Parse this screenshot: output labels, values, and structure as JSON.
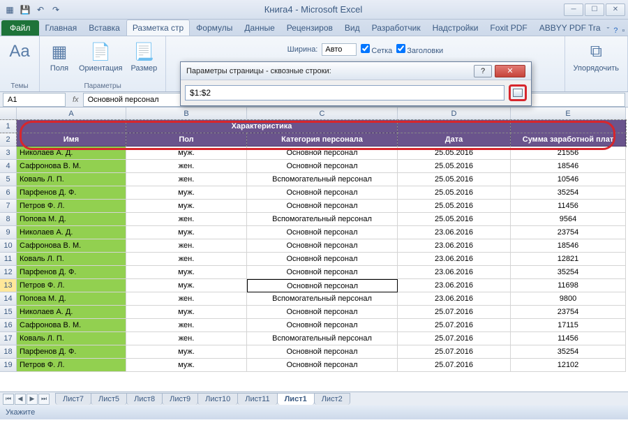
{
  "window": {
    "title": "Книга4 - Microsoft Excel"
  },
  "ribbon": {
    "file": "Файл",
    "tabs": [
      "Главная",
      "Вставка",
      "Разметка стр",
      "Формулы",
      "Данные",
      "Рецензиров",
      "Вид",
      "Разработчик",
      "Надстройки",
      "Foxit PDF",
      "ABBYY PDF Tra"
    ],
    "active_tab": "Разметка стр",
    "groups": {
      "themes": "Темы",
      "fields": "Поля",
      "orient": "Ориентация",
      "size": "Размер",
      "params": "Параметры",
      "arrange": "Упорядочить",
      "width": "Ширина:",
      "height_auto": "Авто",
      "grid": "Сетка",
      "headings": "Заголовки"
    }
  },
  "formula": {
    "namebox": "A1",
    "fx": "fx",
    "value": "Основной персонал"
  },
  "dialog": {
    "title": "Параметры страницы - сквозные строки:",
    "value": "$1:$2"
  },
  "columns": [
    "A",
    "B",
    "C",
    "D",
    "E"
  ],
  "header_row1": {
    "name": "Имя",
    "char": "Характеристика",
    "date": "Дата",
    "salary": "Сумма заработной плат"
  },
  "header_row2": {
    "gender": "Пол",
    "category": "Категория персонала"
  },
  "rows": [
    {
      "n": 3,
      "name": "Николаев А. Д.",
      "g": "муж.",
      "cat": "Основной персонал",
      "d": "25.05.2016",
      "s": "21556"
    },
    {
      "n": 4,
      "name": "Сафронова В. М.",
      "g": "жен.",
      "cat": "Основной персонал",
      "d": "25.05.2016",
      "s": "18546"
    },
    {
      "n": 5,
      "name": "Коваль Л. П.",
      "g": "жен.",
      "cat": "Вспомогательный персонал",
      "d": "25.05.2016",
      "s": "10546"
    },
    {
      "n": 6,
      "name": "Парфенов Д. Ф.",
      "g": "муж.",
      "cat": "Основной персонал",
      "d": "25.05.2016",
      "s": "35254"
    },
    {
      "n": 7,
      "name": "Петров Ф. Л.",
      "g": "муж.",
      "cat": "Основной персонал",
      "d": "25.05.2016",
      "s": "11456"
    },
    {
      "n": 8,
      "name": "Попова М. Д.",
      "g": "жен.",
      "cat": "Вспомогательный персонал",
      "d": "25.05.2016",
      "s": "9564"
    },
    {
      "n": 9,
      "name": "Николаев А. Д.",
      "g": "муж.",
      "cat": "Основной персонал",
      "d": "23.06.2016",
      "s": "23754"
    },
    {
      "n": 10,
      "name": "Сафронова В. М.",
      "g": "жен.",
      "cat": "Основной персонал",
      "d": "23.06.2016",
      "s": "18546"
    },
    {
      "n": 11,
      "name": "Коваль Л. П.",
      "g": "жен.",
      "cat": "Основной персонал",
      "d": "23.06.2016",
      "s": "12821"
    },
    {
      "n": 12,
      "name": "Парфенов Д. Ф.",
      "g": "муж.",
      "cat": "Основной персонал",
      "d": "23.06.2016",
      "s": "35254"
    },
    {
      "n": 13,
      "name": "Петров Ф. Л.",
      "g": "муж.",
      "cat": "Основной персонал",
      "d": "23.06.2016",
      "s": "11698",
      "sel": true
    },
    {
      "n": 14,
      "name": "Попова М. Д.",
      "g": "жен.",
      "cat": "Вспомогательный персонал",
      "d": "23.06.2016",
      "s": "9800"
    },
    {
      "n": 15,
      "name": "Николаев А. Д.",
      "g": "муж.",
      "cat": "Основной персонал",
      "d": "25.07.2016",
      "s": "23754"
    },
    {
      "n": 16,
      "name": "Сафронова В. М.",
      "g": "жен.",
      "cat": "Основной персонал",
      "d": "25.07.2016",
      "s": "17115"
    },
    {
      "n": 17,
      "name": "Коваль Л. П.",
      "g": "жен.",
      "cat": "Вспомогательный персонал",
      "d": "25.07.2016",
      "s": "11456"
    },
    {
      "n": 18,
      "name": "Парфенов Д. Ф.",
      "g": "муж.",
      "cat": "Основной персонал",
      "d": "25.07.2016",
      "s": "35254"
    },
    {
      "n": 19,
      "name": "Петров Ф. Л.",
      "g": "муж.",
      "cat": "Основной персонал",
      "d": "25.07.2016",
      "s": "12102"
    }
  ],
  "sheets": [
    "Лист7",
    "Лист5",
    "Лист8",
    "Лист9",
    "Лист10",
    "Лист11",
    "Лист1",
    "Лист2"
  ],
  "active_sheet": "Лист1",
  "status": "Укажите"
}
